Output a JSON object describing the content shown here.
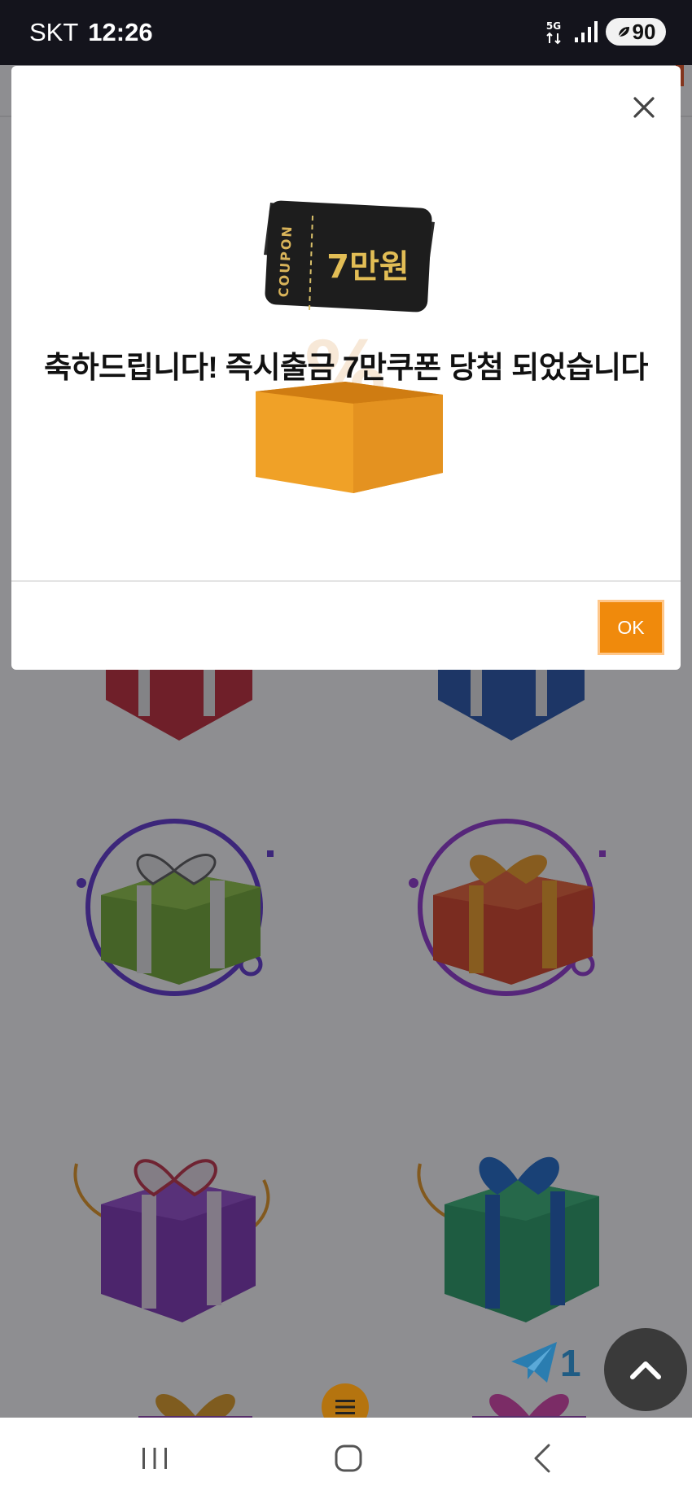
{
  "status_bar": {
    "carrier": "SKT",
    "time": "12:26",
    "network": "5G",
    "battery": "90"
  },
  "modal": {
    "coupon_tag": "COUPON",
    "coupon_amount": "7만원",
    "message": "축하드립니다! 즉시출금 7만쿠폰 당첨 되었습니다",
    "ok_label": "OK"
  },
  "page": {
    "telegram_count": "1"
  },
  "colors": {
    "accent": "#f08a0c",
    "overlay": "#1e1e24"
  },
  "icons": {
    "close": "close-icon",
    "scroll_top": "chevron-up-icon",
    "menu": "menu-icon",
    "telegram": "telegram-icon",
    "nav_recent": "recent-apps-icon",
    "nav_home": "home-icon",
    "nav_back": "back-icon"
  }
}
